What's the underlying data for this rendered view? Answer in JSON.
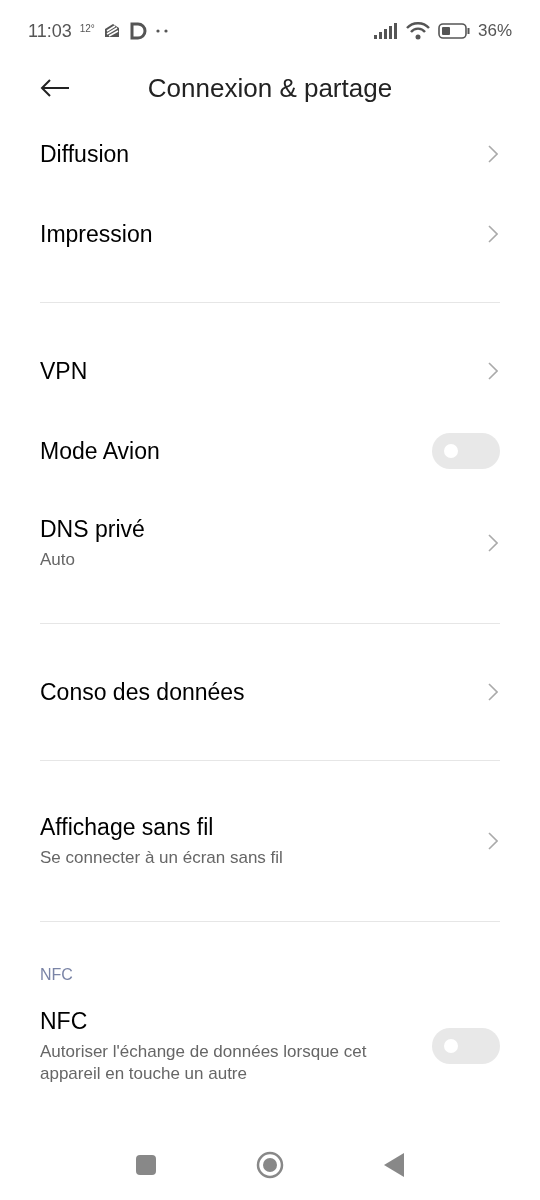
{
  "status_bar": {
    "time": "11:03",
    "temperature": "12°",
    "battery": "36%"
  },
  "header": {
    "title": "Connexion & partage"
  },
  "groups": [
    {
      "items": [
        {
          "kind": "link",
          "title": "Diffusion"
        },
        {
          "kind": "link",
          "title": "Impression"
        }
      ]
    },
    {
      "items": [
        {
          "kind": "link",
          "title": "VPN"
        },
        {
          "kind": "toggle",
          "title": "Mode Avion",
          "on": false
        },
        {
          "kind": "link",
          "title": "DNS privé",
          "subtitle": "Auto"
        }
      ]
    },
    {
      "items": [
        {
          "kind": "link",
          "title": "Conso des données"
        }
      ]
    },
    {
      "items": [
        {
          "kind": "link",
          "title": "Affichage sans fil",
          "subtitle": "Se connecter à un écran sans fil"
        }
      ]
    },
    {
      "header": "NFC",
      "items": [
        {
          "kind": "toggle",
          "title": "NFC",
          "subtitle": "Autoriser l'échange de données lorsque cet appareil en touche un autre",
          "on": false
        }
      ]
    }
  ]
}
